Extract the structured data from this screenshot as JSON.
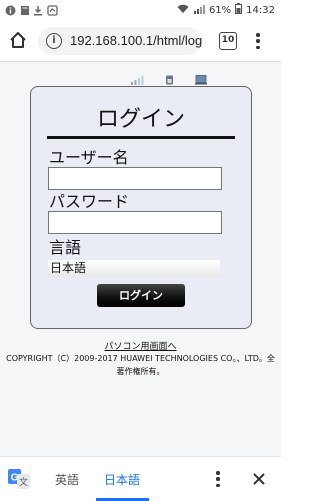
{
  "status_bar": {
    "battery": "61%",
    "time": "14:32"
  },
  "browser": {
    "url": "192.168.100.1/html/log",
    "tab_count": "10",
    "home_icon": "home-icon",
    "info_icon": "info-icon",
    "menu_icon": "more-vert-icon"
  },
  "login": {
    "title": "ログイン",
    "username_label": "ユーザー名",
    "username_value": "",
    "password_label": "パスワード",
    "password_value": "",
    "language_label": "言語",
    "language_selected": "日本語",
    "login_button": "ログイン"
  },
  "footer": {
    "pc_view_link": "パソコン用画面へ",
    "copyright": "COPYRIGHT（C）2009-2017 HUAWEI TECHNOLOGIES CO。、LTD。全著作権所有。"
  },
  "translate_bar": {
    "tab_english": "英語",
    "tab_japanese": "日本語",
    "active_tab": "日本語"
  },
  "colors": {
    "accent": "#1a73e8",
    "login_box_bg": "#eaecf5",
    "page_bg": "#f5f6f8"
  }
}
